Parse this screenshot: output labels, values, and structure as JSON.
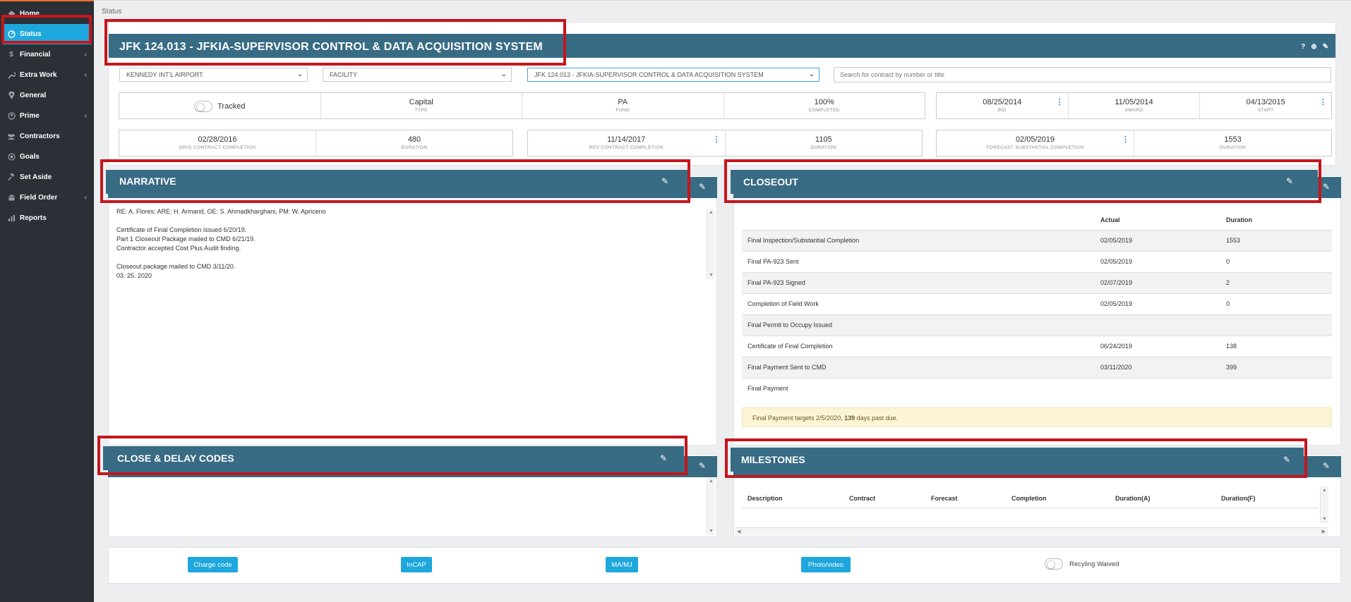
{
  "sidebar": {
    "items": [
      {
        "label": "Home",
        "icon": "home-icon",
        "has_children": false
      },
      {
        "label": "Status",
        "icon": "dashboard-icon",
        "has_children": false,
        "active": true
      },
      {
        "label": "Financial",
        "icon": "dollar-icon",
        "has_children": true
      },
      {
        "label": "Extra Work",
        "icon": "wrench-icon",
        "has_children": true
      },
      {
        "label": "General",
        "icon": "pin-icon",
        "has_children": false
      },
      {
        "label": "Prime",
        "icon": "user-icon",
        "has_children": true
      },
      {
        "label": "Contractors",
        "icon": "users-icon",
        "has_children": false
      },
      {
        "label": "Goals",
        "icon": "target-icon",
        "has_children": false
      },
      {
        "label": "Set Aside",
        "icon": "gavel-icon",
        "has_children": false
      },
      {
        "label": "Field Order",
        "icon": "building-icon",
        "has_children": true
      },
      {
        "label": "Reports",
        "icon": "chart-icon",
        "has_children": false
      }
    ]
  },
  "breadcrumb": "Status",
  "header": {
    "title": "JFK 124.013 - JFKIA-SUPERVISOR CONTROL & DATA ACQUISITION SYSTEM",
    "icons": [
      "help-icon",
      "add-icon",
      "edit-icon"
    ]
  },
  "filters": {
    "airport": "KENNEDY INT'L AIRPORT",
    "category": "FACILITY",
    "contract": "JFK 124.013 - JFKIA-SUPERVISOR CONTROL & DATA ACQUISITION SYSTEM",
    "search_placeholder": "Search for contract by number or title"
  },
  "info": {
    "tracked_label": "Tracked",
    "type": {
      "value": "Capital",
      "label": "TYPE"
    },
    "fund": {
      "value": "PA",
      "label": "FUND"
    },
    "completed": {
      "value": "100%",
      "label": "COMPLETED"
    },
    "bid": {
      "value": "08/25/2014",
      "label": "BID"
    },
    "award": {
      "value": "11/05/2014",
      "label": "AWARD"
    },
    "start": {
      "value": "04/13/2015",
      "label": "START"
    },
    "orig_completion": {
      "value": "02/28/2016",
      "label": "ORIG CONTRACT COMPLETION"
    },
    "orig_duration": {
      "value": "480",
      "label": "DURATION"
    },
    "rev_completion": {
      "value": "11/14/2017",
      "label": "REV CONTRACT COMPLETION"
    },
    "rev_duration": {
      "value": "1105",
      "label": "DURATION"
    },
    "forecast_completion": {
      "value": "02/05/2019",
      "label": "FORECAST SUBSTANTIAL COMPLETION"
    },
    "forecast_duration": {
      "value": "1553",
      "label": "DURATION"
    }
  },
  "narrative": {
    "title": "NARRATIVE",
    "lines": [
      "RE: A. Flores; ARE: H. Armand, OE: S. Ahmadkharghani,  PM: W. Apriceno",
      "",
      "Certificate of Final Completion issued 6/20/19.",
      "Part 1 Closeout Package mailed to CMD 6/21/19.",
      "Contractor accepted Cost Plus Audit finding.",
      "",
      "Closeout package mailed to CMD 3/11/20.",
      "03. 25. 2020"
    ]
  },
  "closeout": {
    "title": "CLOSEOUT",
    "columns": [
      "",
      "Actual",
      "Duration"
    ],
    "rows": [
      {
        "name": "Final Inspection/Substantial Completion",
        "actual": "02/05/2019",
        "duration": "1553"
      },
      {
        "name": "Final PA-923 Sent",
        "actual": "02/05/2019",
        "duration": "0"
      },
      {
        "name": "Final PA-923 Signed",
        "actual": "02/07/2019",
        "duration": "2"
      },
      {
        "name": "Completion of Field Work",
        "actual": "02/05/2019",
        "duration": "0"
      },
      {
        "name": "Final Permit to Occupy Issued",
        "actual": "",
        "duration": ""
      },
      {
        "name": "Certificate of Final Completion",
        "actual": "06/24/2019",
        "duration": "138"
      },
      {
        "name": "Final Payment Sent to CMD",
        "actual": "03/11/2020",
        "duration": "399"
      },
      {
        "name": "Final Payment",
        "actual": "",
        "duration": ""
      }
    ],
    "warning_prefix": "Final Payment targets 2/5/2020,",
    "warning_days": "139",
    "warning_suffix": "days past due."
  },
  "codes": {
    "title": "CLOSE & DELAY CODES"
  },
  "milestones": {
    "title": "MILESTONES",
    "columns": [
      "Description",
      "Contract",
      "Forecast",
      "Completion",
      "Duration(A)",
      "Duration(F)"
    ]
  },
  "footer": {
    "buttons": [
      "Charge code",
      "InCAP",
      "MA/MJ",
      "Photo/video"
    ],
    "recycling_label": "Recyling Waived"
  },
  "colors": {
    "accent": "#1ea7dc",
    "header_bar": "#386b84",
    "highlight": "#c4161c",
    "sidebar": "#2b3036"
  }
}
